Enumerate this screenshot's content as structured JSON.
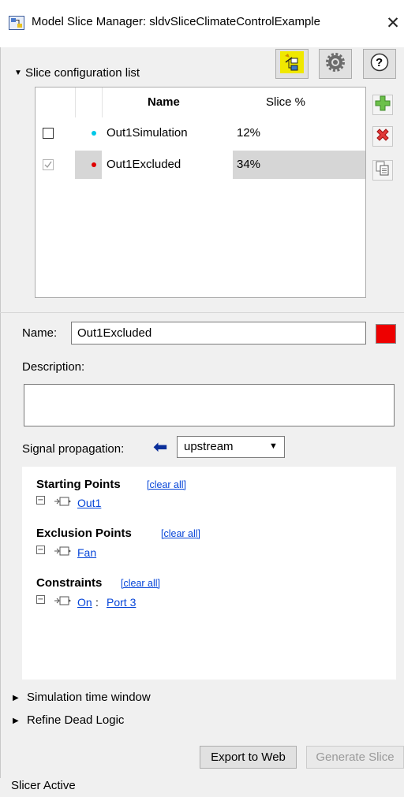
{
  "window": {
    "title": "Model Slice Manager: sldvSliceClimateControlExample",
    "close_glyph": "✕"
  },
  "toolbar": {
    "buttons": [
      {
        "name": "highlight-slice-icon"
      },
      {
        "name": "gear-icon"
      },
      {
        "name": "help-icon",
        "glyph": "?"
      }
    ]
  },
  "slice_list": {
    "title": "Slice configuration list",
    "columns": {
      "name": "Name",
      "slice_pct": "Slice %"
    },
    "rows": [
      {
        "name": "Out1Simulation",
        "pct": "12%",
        "color": "#00c8e8",
        "checked": false,
        "selected": false
      },
      {
        "name": "Out1Excluded",
        "pct": "34%",
        "color": "#e00000",
        "checked": true,
        "selected": true
      }
    ],
    "side_buttons": [
      {
        "name": "add-icon"
      },
      {
        "name": "delete-icon"
      },
      {
        "name": "copy-icon"
      }
    ]
  },
  "form": {
    "name_label": "Name:",
    "name_value": "Out1Excluded",
    "color": "#ee0000",
    "description_label": "Description:",
    "description_value": "",
    "propagation_label": "Signal propagation:",
    "propagation_arrow": "⬅",
    "propagation_value": "upstream"
  },
  "points": {
    "starting": {
      "title": "Starting Points",
      "clear": "[clear all]",
      "items": [
        "Out1"
      ]
    },
    "exclusion": {
      "title": "Exclusion Points",
      "clear": "[clear all]",
      "items": [
        "Fan"
      ]
    },
    "constraints": {
      "title": "Constraints",
      "clear": "[clear all]",
      "item_block": "On",
      "item_sep": ":",
      "item_port": "Port 3"
    }
  },
  "sections": {
    "sim_window": "Simulation time window",
    "refine_dead_logic": "Refine Dead Logic"
  },
  "buttons": {
    "export": "Export to Web",
    "generate": "Generate Slice"
  },
  "status": {
    "text": "Slicer Active"
  }
}
